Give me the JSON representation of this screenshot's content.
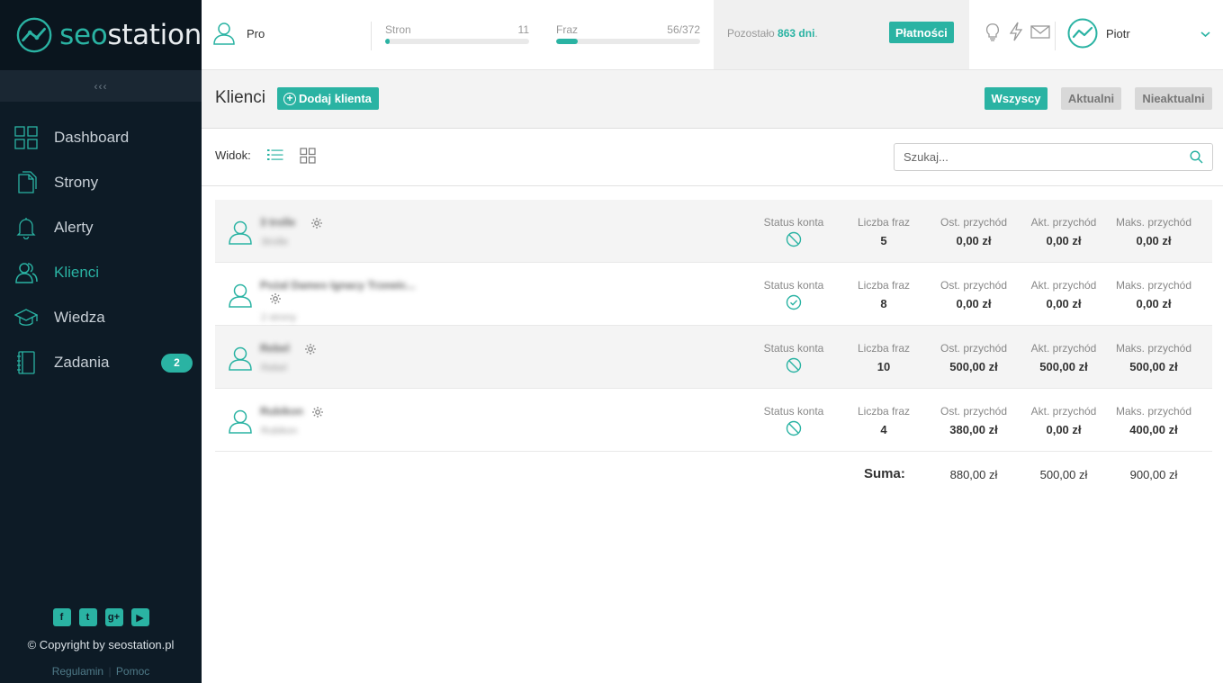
{
  "brand": {
    "name_part1": "seo",
    "name_part2": "station",
    "accent": "#2ab3a3",
    "sidebar_bg": "#0d1b26"
  },
  "sidebar": {
    "collapse_label": "‹‹‹",
    "items": [
      {
        "label": "Dashboard",
        "icon": "dashboard-grid-icon"
      },
      {
        "label": "Strony",
        "icon": "pages-icon"
      },
      {
        "label": "Alerty",
        "icon": "bell-icon"
      },
      {
        "label": "Klienci",
        "icon": "clients-icon",
        "active": true
      },
      {
        "label": "Wiedza",
        "icon": "graduation-cap-icon"
      },
      {
        "label": "Zadania",
        "icon": "notebook-icon",
        "badge": "2"
      }
    ],
    "social": [
      "f",
      "t",
      "g+",
      "▶"
    ],
    "copyright": "© Copyright by seostation.pl",
    "links": {
      "terms": "Regulamin",
      "separator": "|",
      "help": "Pomoc"
    }
  },
  "topbar": {
    "plan": "Pro",
    "pages": {
      "label": "Stron",
      "value": "11",
      "progress": 0.03
    },
    "phrases": {
      "label": "Fraz",
      "value": "56/372",
      "progress": 0.15
    },
    "remaining": {
      "prefix": "Pozostało",
      "value": "863 dni",
      "suffix": "."
    },
    "payments_label": "Płatności",
    "user_name": "Piotr"
  },
  "main": {
    "title": "Klienci",
    "add_client_label": "Dodaj klienta",
    "filters": {
      "all": "Wszyscy",
      "current": "Aktualni",
      "inactive": "Nieaktualni"
    },
    "view_label": "Widok:",
    "search_placeholder": "Szukaj...",
    "columns": {
      "status": "Status konta",
      "phrases": "Liczba fraz",
      "last_income": "Ost. przychód",
      "current_income": "Akt. przychód",
      "max_income": "Maks. przychód"
    },
    "clients": [
      {
        "name": "3 trolle",
        "sub": "3trolle",
        "status": "inactive",
        "phrases": "5",
        "last": "0,00 zł",
        "current": "0,00 zł",
        "max": "0,00 zł"
      },
      {
        "name": "Pożal Dameo Ignacy Trzewic...",
        "sub": "2 strony",
        "status": "active",
        "phrases": "8",
        "last": "0,00 zł",
        "current": "0,00 zł",
        "max": "0,00 zł"
      },
      {
        "name": "Rebel",
        "sub": "Rebel",
        "status": "inactive",
        "phrases": "10",
        "last": "500,00 zł",
        "current": "500,00 zł",
        "max": "500,00 zł"
      },
      {
        "name": "Rubikon",
        "sub": "Rubikon",
        "status": "inactive",
        "phrases": "4",
        "last": "380,00 zł",
        "current": "0,00 zł",
        "max": "400,00 zł"
      }
    ],
    "sum": {
      "label": "Suma:",
      "last": "880,00 zł",
      "current": "500,00 zł",
      "max": "900,00 zł"
    }
  }
}
